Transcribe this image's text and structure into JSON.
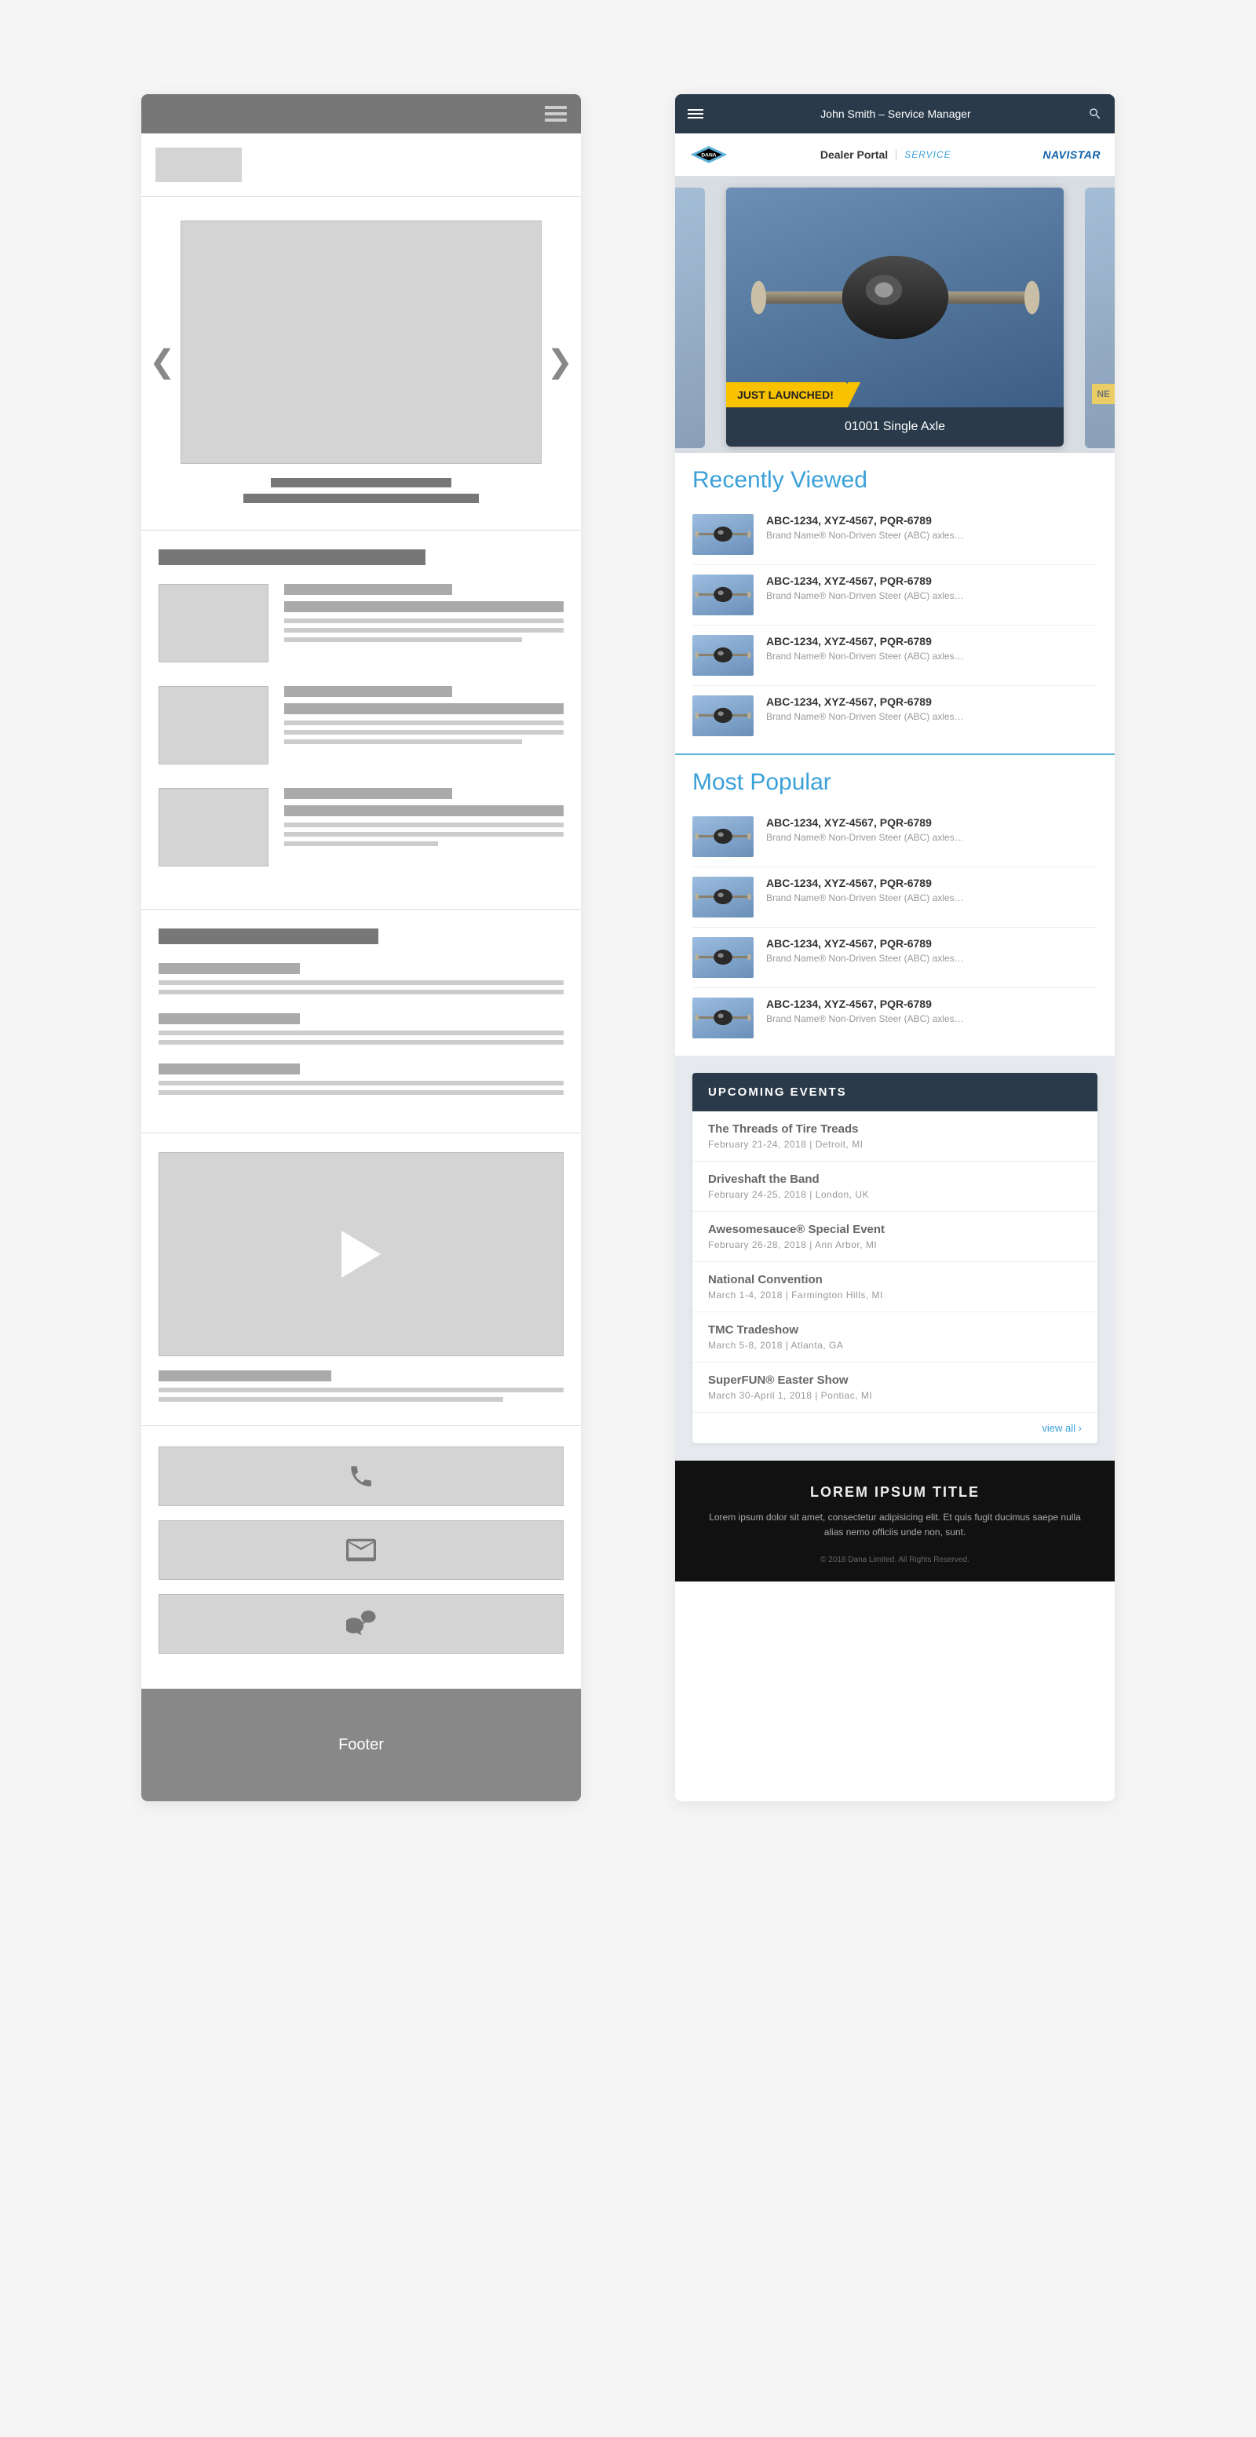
{
  "wireframe": {
    "footer_label": "Footer"
  },
  "mockup": {
    "header": {
      "user_role": "John Smith – Service Manager"
    },
    "brand": {
      "dana": "DANA",
      "dealer": "Dealer Portal",
      "service": "SERVICE",
      "navistar": "NAVISTAR"
    },
    "carousel": {
      "banner": "JUST LAUNCHED!",
      "title": "01001 Single Axle",
      "peek_right_banner": "NE"
    },
    "recently_viewed": {
      "heading": "Recently Viewed",
      "items": [
        {
          "title": "ABC-1234, XYZ-4567, PQR-6789",
          "desc": "Brand Name® Non-Driven Steer (ABC) axles…"
        },
        {
          "title": "ABC-1234, XYZ-4567, PQR-6789",
          "desc": "Brand Name® Non-Driven Steer (ABC) axles…"
        },
        {
          "title": "ABC-1234, XYZ-4567, PQR-6789",
          "desc": "Brand Name® Non-Driven Steer (ABC) axles…"
        },
        {
          "title": "ABC-1234, XYZ-4567, PQR-6789",
          "desc": "Brand Name® Non-Driven Steer (ABC) axles…"
        }
      ]
    },
    "most_popular": {
      "heading": "Most Popular",
      "items": [
        {
          "title": "ABC-1234, XYZ-4567, PQR-6789",
          "desc": "Brand Name® Non-Driven Steer (ABC) axles…"
        },
        {
          "title": "ABC-1234, XYZ-4567, PQR-6789",
          "desc": "Brand Name® Non-Driven Steer (ABC) axles…"
        },
        {
          "title": "ABC-1234, XYZ-4567, PQR-6789",
          "desc": "Brand Name® Non-Driven Steer (ABC) axles…"
        },
        {
          "title": "ABC-1234, XYZ-4567, PQR-6789",
          "desc": "Brand Name® Non-Driven Steer (ABC) axles…"
        }
      ]
    },
    "events": {
      "heading": "UPCOMING EVENTS",
      "items": [
        {
          "title": "The Threads of Tire Treads",
          "meta": "February 21-24, 2018 | Detroit, MI"
        },
        {
          "title": "Driveshaft the Band",
          "meta": "February 24-25, 2018 | London, UK"
        },
        {
          "title": "Awesomesauce® Special Event",
          "meta": "February 26-28, 2018 | Ann Arbor, MI"
        },
        {
          "title": "National Convention",
          "meta": "March 1-4, 2018 | Farmington Hills, MI"
        },
        {
          "title": "TMC Tradeshow",
          "meta": "March 5-8, 2018 | Atlanta, GA"
        },
        {
          "title": "SuperFUN® Easter Show",
          "meta": "March 30-April 1, 2018 | Pontiac, MI"
        }
      ],
      "view_all": "view all ›"
    },
    "footer": {
      "title": "LOREM IPSUM TITLE",
      "body": "Lorem ipsum dolor sit amet, consectetur adipisicing elit. Et quis fugit ducimus saepe nulla alias nemo officiis unde non, sunt.",
      "copy": "© 2018 Dana Limited. All Rights Reserved."
    }
  }
}
